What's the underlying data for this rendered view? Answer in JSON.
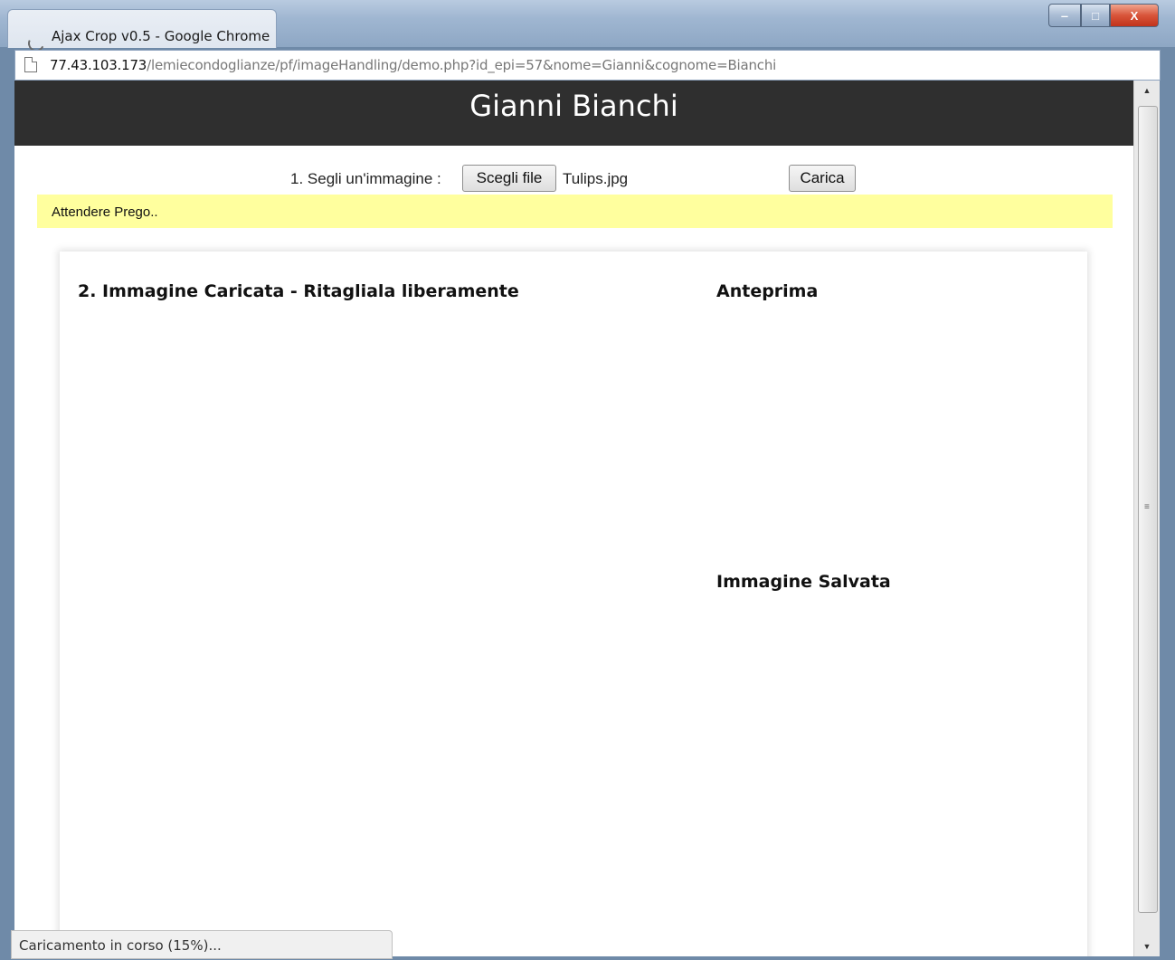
{
  "window": {
    "title": "Ajax Crop v0.5 - Google Chrome",
    "minimize_glyph": "‒",
    "maximize_glyph": "□",
    "close_glyph": "X"
  },
  "address": {
    "host": "77.43.103.173",
    "path": "/lemiecondoglianze/pf/imageHandling/demo.php?id_epi=57&nome=Gianni&cognome=Bianchi"
  },
  "page": {
    "header_title": "Gianni Bianchi",
    "upload": {
      "label": "1. Segli un'immagine :",
      "choose_button": "Scegli file",
      "filename": "Tulips.jpg",
      "upload_button": "Carica"
    },
    "status_message": "Attendere Prego..",
    "panel": {
      "uploaded_title": "2. Immagine Caricata - Ritagliala liberamente",
      "preview_title": "Anteprima",
      "saved_title": "Immagine Salvata"
    }
  },
  "browser_status": {
    "loading_text": "Caricamento in corso (15%)..."
  },
  "icons": {
    "page": "page-icon",
    "spinner": "loading-spinner-icon",
    "scroll_up": "▲",
    "scroll_down": "▼",
    "scroll_grip": "≡"
  },
  "colors": {
    "header_bg": "#2f2f2f",
    "status_bg": "#ffff9e",
    "window_frame": "#6f8aa8"
  }
}
